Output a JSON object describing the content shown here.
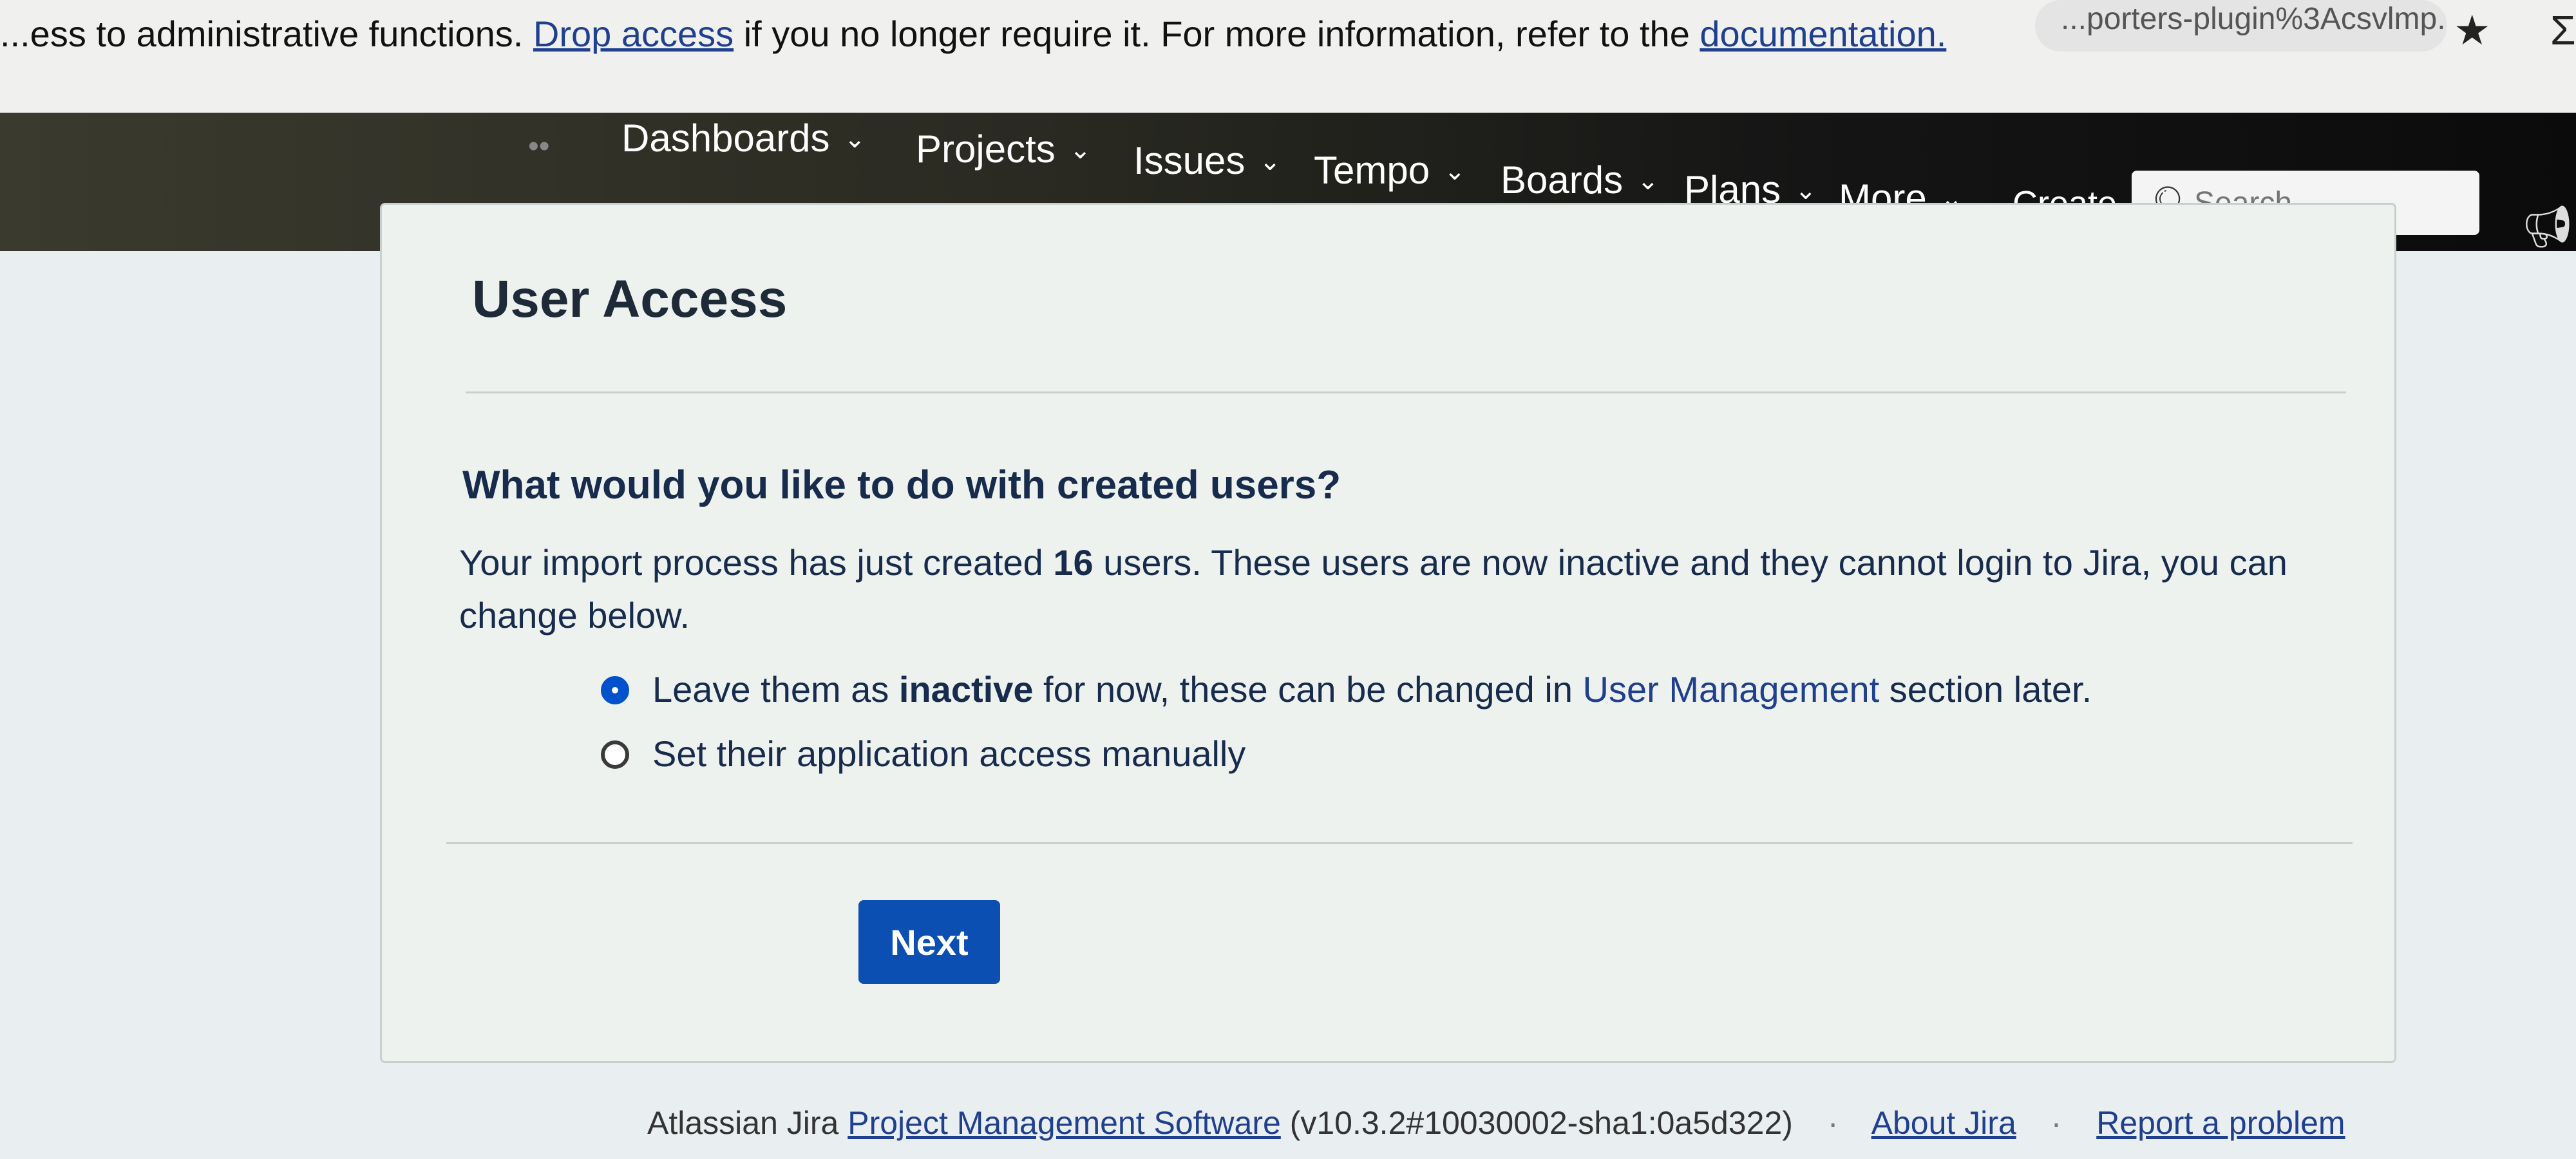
{
  "banner": {
    "message_prefix": "...ess to administrative functions.",
    "drop_access_link": "Drop access",
    "message_middle": "if you no longer require it. For more information, refer to the",
    "documentation_link": "documentation.",
    "url_fragment": "...porters-plugin%3Acsvlmp...",
    "star_icon": "★",
    "extension_icon": "Σ"
  },
  "nav": {
    "logo_icon": "••",
    "items": [
      {
        "label": "Dashboards"
      },
      {
        "label": "Projects"
      },
      {
        "label": "Issues"
      },
      {
        "label": "Tempo"
      },
      {
        "label": "Boards"
      },
      {
        "label": "Plans"
      },
      {
        "label": "More"
      }
    ],
    "create_label": "Create",
    "search_placeholder": "Search",
    "chevron": "⌄"
  },
  "page": {
    "title": "User Access",
    "question": "What would you like to do with created users?",
    "desc_before": "Your import process has just created",
    "user_count": "16",
    "desc_after": "users. These users are now inactive and they cannot login to Jira, you can change below."
  },
  "options": {
    "option1": {
      "before": "Leave them as",
      "bold": "inactive",
      "middle": "for now, these can be changed in",
      "link": "User Management",
      "after": "section later.",
      "selected": true
    },
    "option2": {
      "label": "Set their application access manually",
      "selected": false
    }
  },
  "actions": {
    "next_label": "Next"
  },
  "footer": {
    "prefix": "Atlassian Jira",
    "pms_link": "Project Management Software",
    "version": "(v10.3.2#10030002-sha1:0a5d322)",
    "about_link": "About Jira",
    "report_link": "Report a problem",
    "separator": "·"
  },
  "colors": {
    "primary": "#0b4fb3",
    "link": "#1f3f8f",
    "nav_bg": "#151515"
  }
}
